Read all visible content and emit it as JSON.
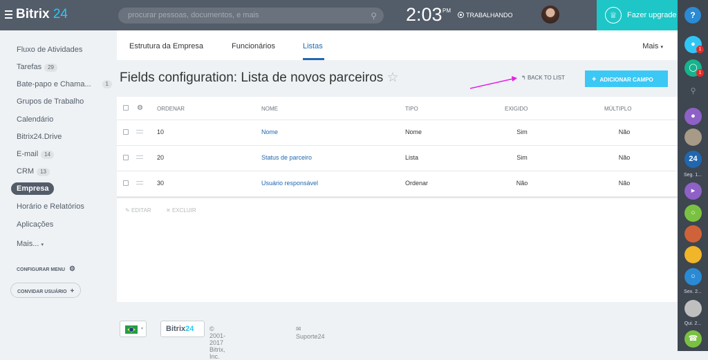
{
  "header": {
    "brand_main": "Bitrix",
    "brand_num": "24",
    "search_placeholder": "procurar pessoas, documentos, e mais",
    "time": "2:03",
    "ampm": "PM",
    "work_status": "TRABALHANDO",
    "upgrade_label": "Fazer upgrade"
  },
  "sidebar": {
    "items": [
      {
        "label": "Fluxo de Atividades",
        "count": ""
      },
      {
        "label": "Tarefas",
        "count": "29"
      },
      {
        "label": "Bate-papo e Chama...",
        "count": "1"
      },
      {
        "label": "Grupos de Trabalho",
        "count": ""
      },
      {
        "label": "Calendário",
        "count": ""
      },
      {
        "label": "Bitrix24.Drive",
        "count": ""
      },
      {
        "label": "E-mail",
        "count": "14"
      },
      {
        "label": "CRM",
        "count": "13"
      },
      {
        "label": "Empresa",
        "count": ""
      },
      {
        "label": "Horário e Relatórios",
        "count": ""
      },
      {
        "label": "Aplicações",
        "count": ""
      },
      {
        "label": "Mais...",
        "count": ""
      }
    ],
    "config_menu": "CONFIGURAR MENU",
    "invite_users": "CONVIDAR USUÁRIO"
  },
  "tabs": [
    {
      "label": "Estrutura da Empresa"
    },
    {
      "label": "Funcionários"
    },
    {
      "label": "Listas"
    }
  ],
  "more_label": "Mais",
  "page_title": "Fields configuration: Lista de novos parceiros",
  "back_to_list": "BACK TO LIST",
  "add_field": "ADICIONAR CAMPO",
  "table": {
    "headers": {
      "order": "ORDENAR",
      "name": "NOME",
      "type": "TIPO",
      "required": "EXIGIDO",
      "multiple": "MÚLTIPLO"
    },
    "rows": [
      {
        "order": "10",
        "name": "Nome",
        "type": "Nome",
        "required": "Sim",
        "multiple": "Não"
      },
      {
        "order": "20",
        "name": "Status de parceiro",
        "type": "Lista",
        "required": "Sim",
        "multiple": "Não"
      },
      {
        "order": "30",
        "name": "Usuário responsável",
        "type": "Ordenar",
        "required": "Não",
        "multiple": "Não"
      }
    ]
  },
  "actions": {
    "edit": "EDITAR",
    "delete": "EXCLUIR"
  },
  "footer": {
    "b24": "Bitrix",
    "b24num": "24",
    "copyright": "© 2001-2017 Bitrix, Inc.",
    "support": "Suporte24"
  },
  "rightbar": {
    "help": "?",
    "badge1": "1",
    "badge2": "1",
    "chat_24": "24",
    "label_seg": "Seg. 1...",
    "label_sex": "Sex. 2...",
    "label_qui": "Qui. 2..."
  },
  "colors": {
    "header": "#535c69",
    "accent": "#2fc6f6",
    "upgrade": "#1ec6c7",
    "link": "#2067b0",
    "button": "#3bc8f5"
  }
}
